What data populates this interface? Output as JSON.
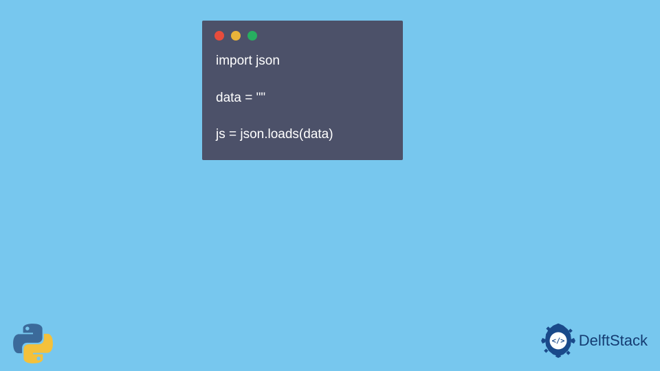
{
  "code": {
    "line1": "import json",
    "line2": "data = \"\"",
    "line3": "js = json.loads(data)"
  },
  "watermark": {
    "text": "DelftStack"
  },
  "colors": {
    "background": "#77c7ee",
    "window": "#4c5169",
    "dot_red": "#e74c3c",
    "dot_yellow": "#e8b339",
    "dot_green": "#27ae60",
    "code_text": "#ffffff",
    "watermark_text": "#143c72",
    "python_blue": "#3b6a9a",
    "python_yellow": "#f4c13b"
  }
}
